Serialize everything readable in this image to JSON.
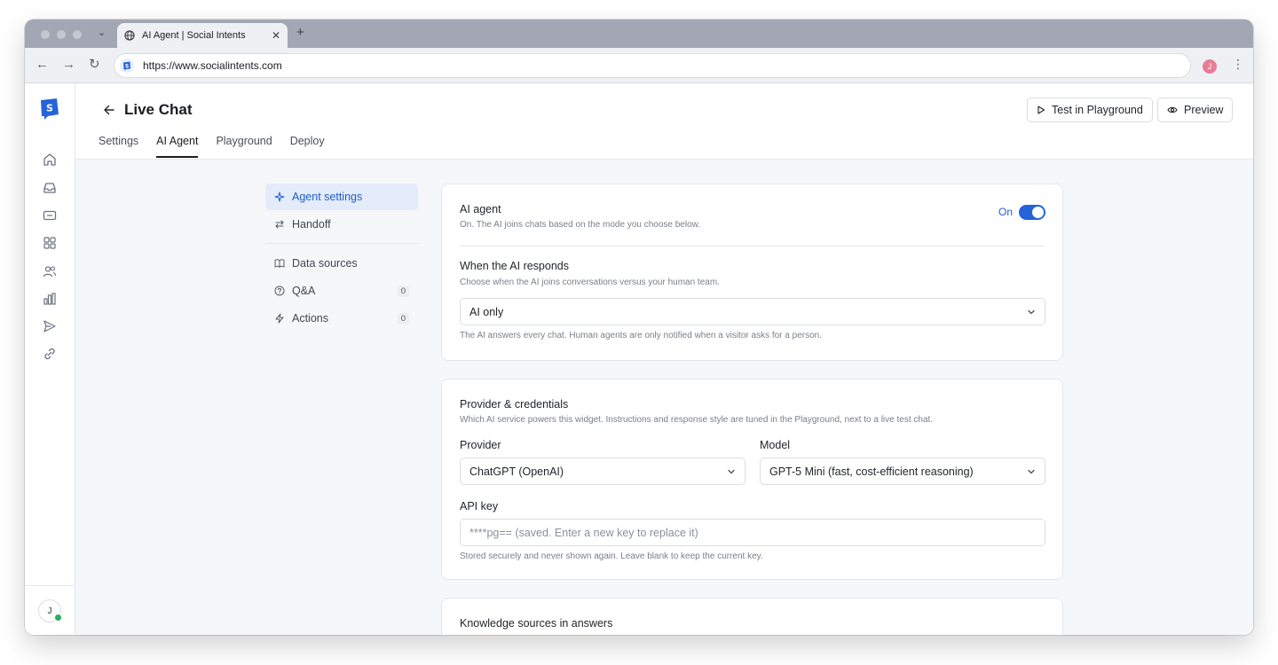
{
  "browser": {
    "tab_title": "AI Agent | Social Intents",
    "url": "https://www.socialintents.com",
    "profile_initial": "J"
  },
  "rail": {
    "user_initial": "J",
    "icons": [
      "home-icon",
      "inbox-icon",
      "ticket-icon",
      "apps-icon",
      "users-icon",
      "chart-icon",
      "send-icon",
      "link-icon"
    ]
  },
  "header": {
    "title": "Live Chat",
    "test_button": "Test in Playground",
    "preview_button": "Preview",
    "tabs": [
      "Settings",
      "AI Agent",
      "Playground",
      "Deploy"
    ],
    "active_tab": "AI Agent"
  },
  "subnav": {
    "items": [
      {
        "label": "Agent settings",
        "icon": "sparkle-icon",
        "active": true
      },
      {
        "label": "Handoff",
        "icon": "swap-icon"
      },
      {
        "label": "Data sources",
        "icon": "book-icon"
      },
      {
        "label": "Q&A",
        "icon": "question-icon",
        "count": "0"
      },
      {
        "label": "Actions",
        "icon": "bolt-icon",
        "count": "0"
      }
    ]
  },
  "ai_agent_card": {
    "title": "AI agent",
    "status_hint": "On. The AI joins chats based on the mode you choose below.",
    "toggle_label": "On",
    "toggle_on": true,
    "responds_title": "When the AI responds",
    "responds_hint": "Choose when the AI joins conversations versus your human team.",
    "mode_value": "AI only",
    "mode_hint": "The AI answers every chat. Human agents are only notified when a visitor asks for a person."
  },
  "provider_card": {
    "title": "Provider & credentials",
    "hint": "Which AI service powers this widget. Instructions and response style are tuned in the Playground, next to a live test chat.",
    "provider_label": "Provider",
    "provider_value": "ChatGPT (OpenAI)",
    "model_label": "Model",
    "model_value": "GPT-5 Mini (fast, cost-efficient reasoning)",
    "api_key_label": "API key",
    "api_key_placeholder": "****pg== (saved. Enter a new key to replace it)",
    "api_key_hint": "Stored securely and never shown again. Leave blank to keep the current key."
  },
  "knowledge_card": {
    "title": "Knowledge sources in answers"
  },
  "colors": {
    "accent": "#2563d9",
    "active_nav_bg": "#e4ebfa",
    "online": "#22b35e"
  }
}
